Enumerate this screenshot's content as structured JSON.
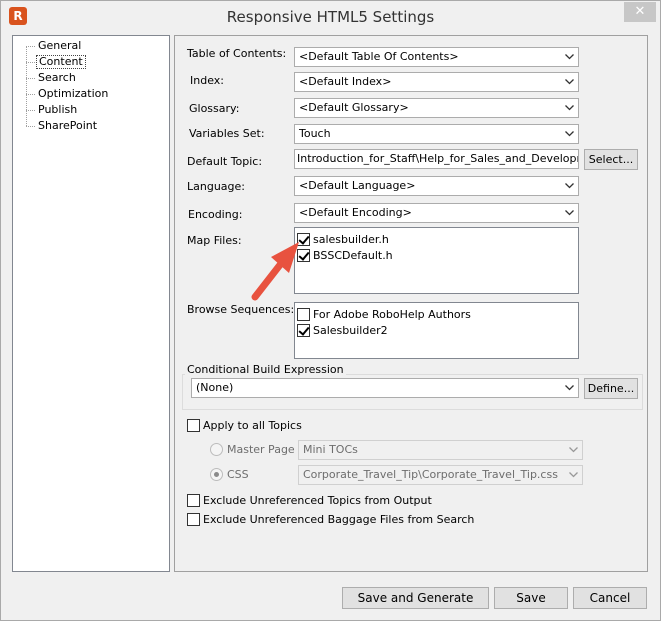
{
  "window": {
    "title": "Responsive HTML5 Settings",
    "close_glyph": "✕",
    "app_icon_letter": "R"
  },
  "tree": {
    "items": [
      {
        "label": "General"
      },
      {
        "label": "Content",
        "selected": true
      },
      {
        "label": "Search"
      },
      {
        "label": "Optimization"
      },
      {
        "label": "Publish"
      },
      {
        "label": "SharePoint"
      }
    ]
  },
  "content": {
    "toc": {
      "label": "Table of Contents:",
      "value": "<Default Table Of Contents>"
    },
    "index": {
      "label": "Index:",
      "value": "<Default Index>"
    },
    "glossary": {
      "label": "Glossary:",
      "value": "<Default Glossary>"
    },
    "variables": {
      "label": "Variables Set:",
      "value": "Touch"
    },
    "default_topic": {
      "label": "Default Topic:",
      "value": "Introduction_for_Staff\\Help_for_Sales_and_Development.htm",
      "button": "Select..."
    },
    "language": {
      "label": "Language:",
      "value": "<Default Language>"
    },
    "encoding": {
      "label": "Encoding:",
      "value": "<Default Encoding>"
    },
    "map_files": {
      "label": "Map Files:",
      "items": [
        {
          "label": "salesbuilder.h",
          "checked": true
        },
        {
          "label": "BSSCDefault.h",
          "checked": true
        }
      ]
    },
    "browse_sequences": {
      "label": "Browse Sequences:",
      "items": [
        {
          "label": "For Adobe RoboHelp Authors",
          "checked": false
        },
        {
          "label": "Salesbuilder2",
          "checked": true
        }
      ]
    },
    "conditional": {
      "label": "Conditional Build Expression",
      "value": "(None)",
      "button": "Define..."
    },
    "apply_all": {
      "label": "Apply to all Topics",
      "checked": false
    },
    "master_page": {
      "label": "Master Page",
      "value": "Mini TOCs",
      "selected": false
    },
    "css": {
      "label": "CSS",
      "value": "Corporate_Travel_Tip\\Corporate_Travel_Tip.css",
      "selected": true
    },
    "exclude_topics": {
      "label": "Exclude Unreferenced Topics from Output",
      "checked": false
    },
    "exclude_baggage": {
      "label": "Exclude Unreferenced Baggage Files from Search",
      "checked": false
    }
  },
  "footer": {
    "save_generate": "Save and Generate",
    "save": "Save",
    "cancel": "Cancel"
  },
  "colors": {
    "annotation_arrow": "#e8523f",
    "app_icon": "#d9531e"
  }
}
